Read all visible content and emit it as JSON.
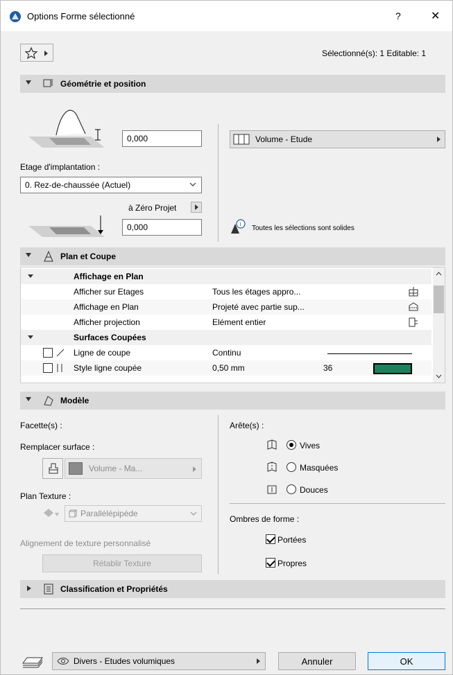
{
  "window": {
    "title": "Options Forme sélectionné",
    "help": "?",
    "close": "✕",
    "selection_info": "Sélectionné(s): 1 Editable: 1"
  },
  "sections": {
    "geometry": "Géométrie et position",
    "plan": "Plan et Coupe",
    "model": "Modèle",
    "classification": "Classification et Propriétés"
  },
  "geometry": {
    "top_offset": "0,000",
    "building_material": "Volume - Etude",
    "home_story_label": "Etage d'implantation :",
    "home_story_value": "0. Rez-de-chaussée (Actuel)",
    "to_project_zero_label": "à Zéro Projet",
    "bottom_offset": "0,000",
    "solid_note": "Toutes les sélections sont solides"
  },
  "plan_tree": {
    "group1": "Affichage en Plan",
    "rows1": [
      {
        "label": "Afficher sur Etages",
        "value": "Tous les étages appro..."
      },
      {
        "label": "Affichage en Plan",
        "value": "Projeté avec partie sup..."
      },
      {
        "label": "Afficher projection",
        "value": "Elément entier"
      }
    ],
    "group2": "Surfaces Coupées",
    "cut_line_label": "Ligne de coupe",
    "cut_line_value": "Continu",
    "cut_style_label": "Style ligne coupée",
    "cut_style_value": "0,50 mm",
    "cut_style_num": "36"
  },
  "model": {
    "faces_label": "Facette(s) :",
    "override_label": "Remplacer surface :",
    "override_value": "Volume - Ma...",
    "texture_label": "Plan Texture :",
    "texture_value": "Parallélépipède",
    "align_label": "Alignement de texture personnalisé",
    "reset_texture": "Rétablir Texture",
    "edges_label": "Arête(s) :",
    "edge_options": [
      "Vives",
      "Masquées",
      "Douces"
    ],
    "shadows_label": "Ombres de forme :",
    "shadow_options": [
      "Portées",
      "Propres"
    ]
  },
  "footer": {
    "layer": "Divers - Etudes volumiques",
    "cancel": "Annuler",
    "ok": "OK"
  },
  "colors": {
    "section_bg": "#d9d9d9",
    "accent_blue": "#0078d7",
    "swatch_green": "#1e7f5c"
  }
}
